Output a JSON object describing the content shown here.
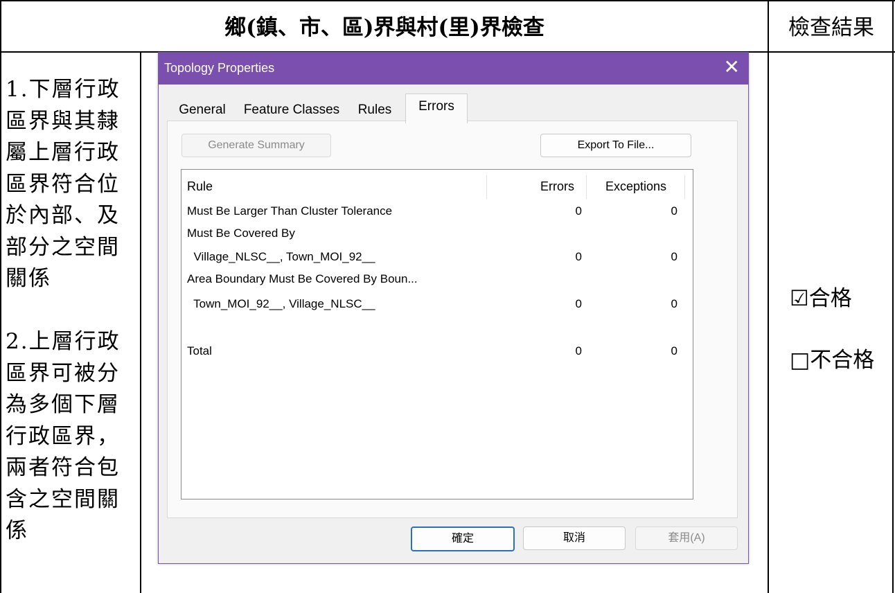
{
  "document": {
    "header_title": "鄉(鎮、市、區)界與村(里)界檢查",
    "header_result": "檢查結果",
    "left_lines": [
      "1.下層行政",
      "區界與其隸",
      "屬上層行政",
      "區界符合位",
      "於內部、及",
      "部分之空間",
      "關係",
      "",
      "2.上層行政",
      "區界可被分",
      "為多個下層",
      "行政區界，",
      "兩者符合包",
      "含之空間關",
      "係"
    ],
    "result_pass": "☑合格",
    "result_fail": "□不合格"
  },
  "dialog": {
    "title": "Topology Properties",
    "close_glyph": "✕",
    "tabs": [
      "General",
      "Feature Classes",
      "Rules",
      "Errors"
    ],
    "active_tab": "Errors",
    "generate_summary": "Generate Summary",
    "export_to_file": "Export To File...",
    "columns": [
      "Rule",
      "Errors",
      "Exceptions"
    ],
    "rows": [
      {
        "rule": "Must Be Larger Than Cluster Tolerance",
        "errors": "0",
        "exceptions": "0"
      },
      {
        "rule": "Must Be Covered By",
        "errors": "",
        "exceptions": ""
      },
      {
        "rule": "  Village_NLSC__, Town_MOI_92__",
        "errors": "0",
        "exceptions": "0"
      },
      {
        "rule": "Area Boundary Must Be Covered By Boun...",
        "errors": "",
        "exceptions": ""
      },
      {
        "rule": "  Town_MOI_92__, Village_NLSC__",
        "errors": "0",
        "exceptions": "0"
      },
      {
        "rule": "",
        "errors": "",
        "exceptions": ""
      },
      {
        "rule": "Total",
        "errors": "0",
        "exceptions": "0"
      }
    ],
    "ok": "確定",
    "cancel": "取消",
    "apply": "套用(A)"
  },
  "colors": {
    "titlebar": "#7b4fae",
    "primary_border": "#2b6fc0"
  }
}
